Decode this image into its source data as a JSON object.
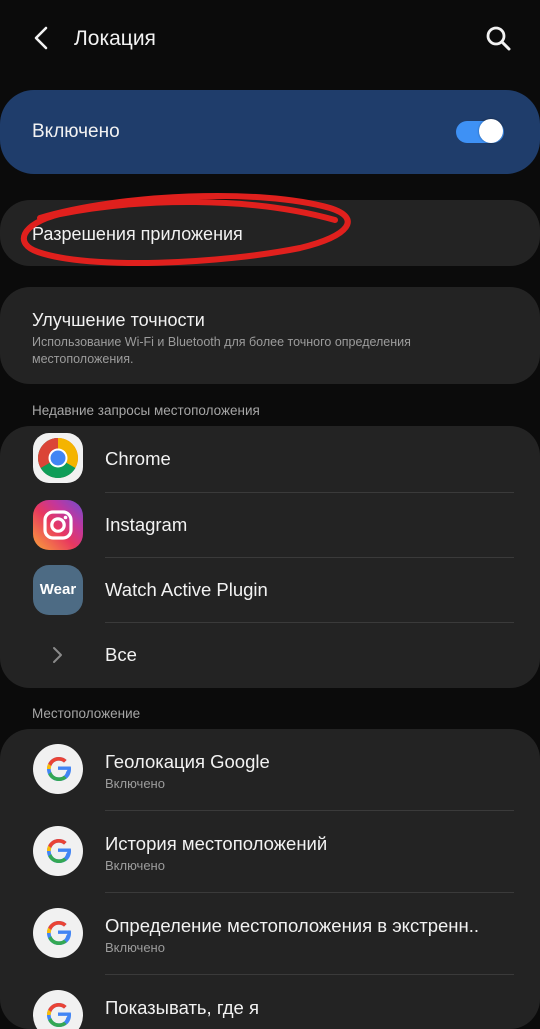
{
  "header": {
    "title": "Локация",
    "back_icon": "back-arrow-icon",
    "search_icon": "search-icon"
  },
  "master_switch": {
    "label": "Включено",
    "state": "on",
    "accent_color": "#3e91f5",
    "card_color": "#1f3d6b"
  },
  "app_permissions": {
    "label": "Разрешения приложения",
    "annotation_color": "#e0201d"
  },
  "accuracy": {
    "title": "Улучшение точности",
    "subtitle": "Использование Wi-Fi и Bluetooth для более точного определения местоположения."
  },
  "recent": {
    "header": "Недавние запросы местоположения",
    "items": [
      {
        "label": "Chrome",
        "icon": "chrome-icon"
      },
      {
        "label": "Instagram",
        "icon": "instagram-icon"
      },
      {
        "label": "Watch Active Plugin",
        "icon": "wear-icon",
        "icon_text": "Wear"
      }
    ],
    "all_label": "Все"
  },
  "location_services": {
    "header": "Местоположение",
    "items": [
      {
        "label": "Геолокация Google",
        "status": "Включено",
        "icon": "google-icon"
      },
      {
        "label": "История местоположений",
        "status": "Включено",
        "icon": "google-icon"
      },
      {
        "label": "Определение местоположения в экстренн..",
        "status": "Включено",
        "icon": "google-icon"
      },
      {
        "label": "Показывать, где я",
        "icon": "google-icon"
      }
    ]
  }
}
